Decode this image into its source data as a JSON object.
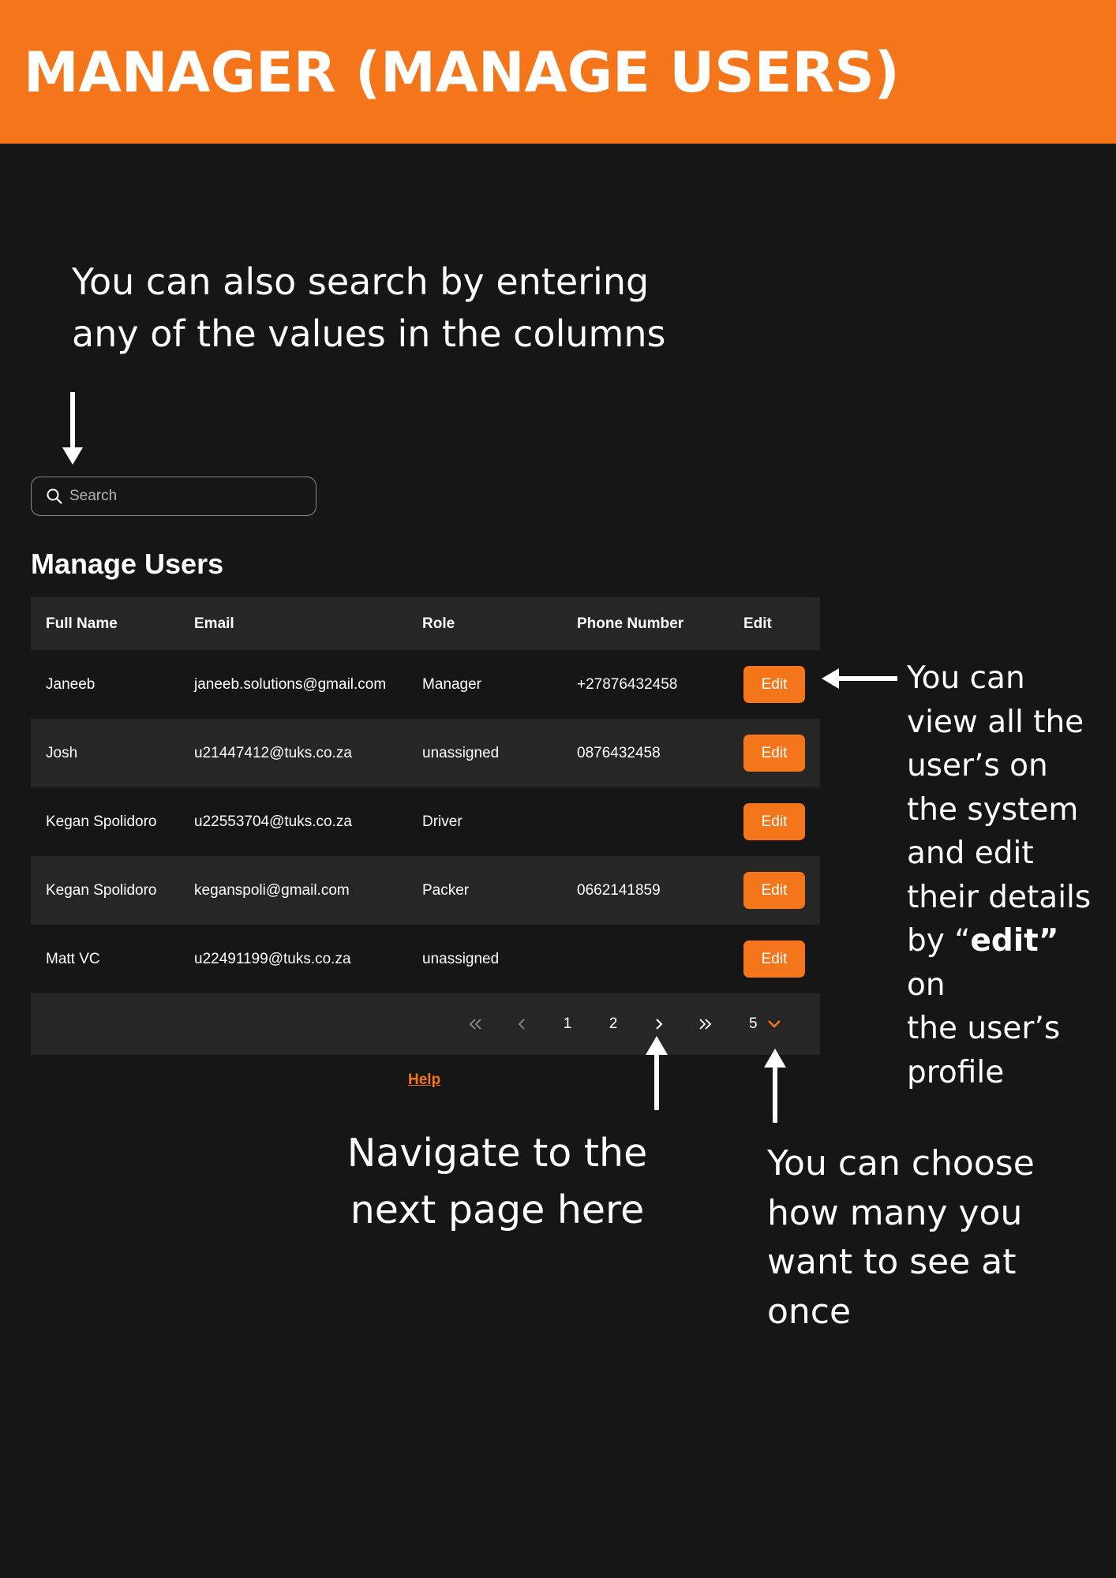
{
  "banner": {
    "title": "MANAGER (MANAGE USERS)"
  },
  "annotations": {
    "search_line1": "You can also search by entering",
    "search_line2": "any of the values in the columns",
    "edit_l1": "You can",
    "edit_l2": "view all the",
    "edit_l3": "user’s on",
    "edit_l4": "the system",
    "edit_l5": "and edit",
    "edit_l6": "their details",
    "edit_l7_pre": "by “",
    "edit_l7_bold": "edit”",
    "edit_l7_post": " on",
    "edit_l8": "the user’s",
    "edit_l9": "profile",
    "next_l1": "Navigate to the",
    "next_l2": "next page here",
    "per_l1": "You can choose",
    "per_l2": "how many you",
    "per_l3": "want to see at",
    "per_l4": "once"
  },
  "search": {
    "placeholder": "Search",
    "value": "",
    "icon": "search-icon"
  },
  "page_title": "Manage Users",
  "table": {
    "headers": {
      "name": "Full Name",
      "email": "Email",
      "role": "Role",
      "phone": "Phone Number",
      "edit": "Edit"
    },
    "rows": [
      {
        "name": "Janeeb",
        "email": "janeeb.solutions@gmail.com",
        "role": "Manager",
        "phone": "+27876432458",
        "edit": "Edit"
      },
      {
        "name": "Josh",
        "email": "u21447412@tuks.co.za",
        "role": "unassigned",
        "phone": "0876432458",
        "edit": "Edit"
      },
      {
        "name": "Kegan Spolidoro",
        "email": "u22553704@tuks.co.za",
        "role": "Driver",
        "phone": "",
        "edit": "Edit"
      },
      {
        "name": "Kegan Spolidoro",
        "email": "keganspoli@gmail.com",
        "role": "Packer",
        "phone": "0662141859",
        "edit": "Edit"
      },
      {
        "name": "Matt VC",
        "email": "u22491199@tuks.co.za",
        "role": "unassigned",
        "phone": "",
        "edit": "Edit"
      }
    ]
  },
  "pagination": {
    "pages": [
      "1",
      "2"
    ],
    "per_page": "5",
    "icons": [
      "first-page-icon",
      "prev-page-icon",
      "next-page-icon",
      "last-page-icon",
      "chevron-down-icon"
    ]
  },
  "help_link": "Help",
  "colors": {
    "accent": "#f5751a",
    "background": "#161616",
    "row_alt": "#262626"
  }
}
